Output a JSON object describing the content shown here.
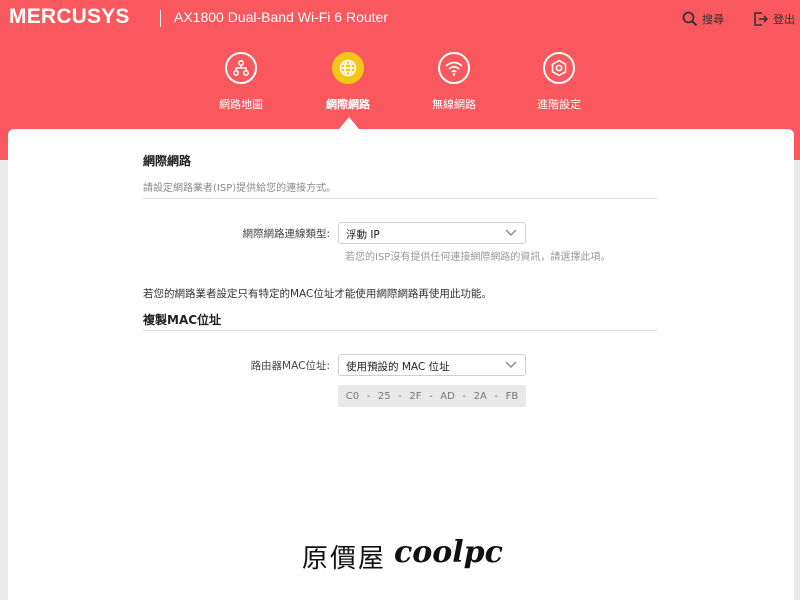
{
  "header": {
    "brand": "MERCUSYS",
    "model": "AX1800 Dual-Band Wi-Fi 6 Router",
    "search_label": "搜尋",
    "logout_label": "登出",
    "accent_color": "#f9595e"
  },
  "nav": {
    "items": [
      {
        "label": "網路地圖",
        "icon": "network-map-icon"
      },
      {
        "label": "網際網路",
        "icon": "globe-icon",
        "active": true
      },
      {
        "label": "無線網路",
        "icon": "wifi-icon"
      },
      {
        "label": "進階設定",
        "icon": "gear-icon"
      }
    ]
  },
  "internet": {
    "title": "網際網路",
    "subtitle": "請設定網路業者(ISP)提供給您的連接方式。",
    "conn_type_label": "網際網路連線類型:",
    "conn_type_value": "浮動 IP",
    "conn_type_hint": "若您的ISP沒有提供任何連接網際網路的資訊，請選擇此項。"
  },
  "mac": {
    "info": "若您的網路業者設定只有特定的MAC位址才能使用網際網路再使用此功能。",
    "title": "複製MAC位址",
    "router_mac_label": "路由器MAC位址:",
    "router_mac_value": "使用預設的 MAC 位址",
    "octets": [
      "C0",
      "25",
      "2F",
      "AD",
      "2A",
      "FB"
    ],
    "octet_sep": "-"
  },
  "watermark": {
    "cn": "原價屋",
    "en": "coolpc"
  }
}
